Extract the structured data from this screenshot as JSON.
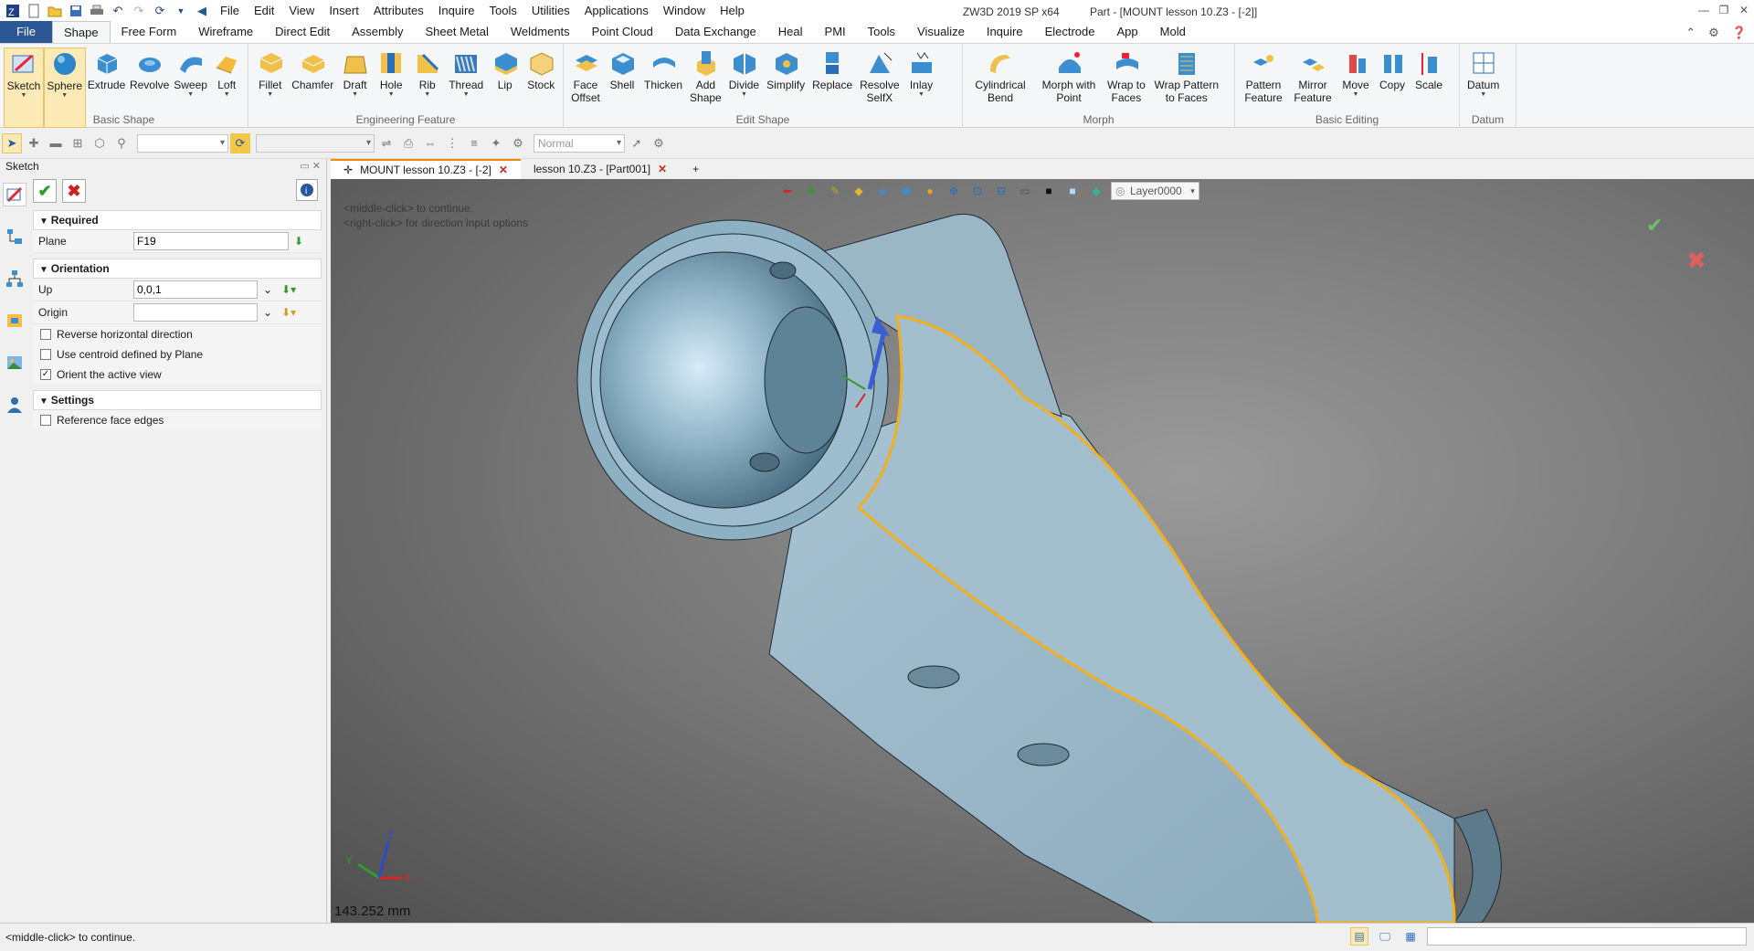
{
  "titlebar": {
    "app_title": "ZW3D 2019 SP x64",
    "doc_title": "Part - [MOUNT lesson 10.Z3 - [-2]]",
    "menus": [
      "File",
      "Edit",
      "View",
      "Insert",
      "Attributes",
      "Inquire",
      "Tools",
      "Utilities",
      "Applications",
      "Window",
      "Help"
    ]
  },
  "ribbon_tabs": [
    "File",
    "Shape",
    "Free Form",
    "Wireframe",
    "Direct Edit",
    "Assembly",
    "Sheet Metal",
    "Weldments",
    "Point Cloud",
    "Data Exchange",
    "Heal",
    "PMI",
    "Tools",
    "Visualize",
    "Inquire",
    "Electrode",
    "App",
    "Mold"
  ],
  "active_tab": "Shape",
  "ribbon": {
    "basic_shape": {
      "label": "Basic Shape",
      "buttons": [
        "Sketch",
        "Sphere",
        "Extrude",
        "Revolve",
        "Sweep",
        "Loft"
      ]
    },
    "engineering_feature": {
      "label": "Engineering Feature",
      "buttons": [
        "Fillet",
        "Chamfer",
        "Draft",
        "Hole",
        "Rib",
        "Thread",
        "Lip",
        "Stock"
      ]
    },
    "edit_shape": {
      "label": "Edit Shape",
      "buttons": [
        "Face\nOffset",
        "Shell",
        "Thicken",
        "Add\nShape",
        "Divide",
        "Simplify",
        "Replace",
        "Resolve\nSelfX",
        "Inlay"
      ]
    },
    "morph": {
      "label": "Morph",
      "buttons": [
        "Cylindrical\nBend",
        "Morph with\nPoint",
        "Wrap to\nFaces",
        "Wrap Pattern\nto Faces"
      ]
    },
    "basic_editing": {
      "label": "Basic Editing",
      "buttons": [
        "Pattern\nFeature",
        "Mirror\nFeature",
        "Move",
        "Copy",
        "Scale"
      ]
    },
    "datum": {
      "label": "Datum",
      "buttons": [
        "Datum"
      ]
    }
  },
  "toolbar2": {
    "render_mode": "Normal"
  },
  "panel": {
    "title": "Sketch",
    "required": {
      "label": "Required",
      "plane_label": "Plane",
      "plane_value": "F19"
    },
    "orientation": {
      "label": "Orientation",
      "up_label": "Up",
      "up_value": "0,0,1",
      "origin_label": "Origin",
      "origin_value": "",
      "reverse_horizontal": "Reverse horizontal direction",
      "use_centroid": "Use centroid defined by Plane",
      "orient_view": "Orient the active view",
      "reverse_horizontal_checked": false,
      "use_centroid_checked": false,
      "orient_view_checked": true
    },
    "settings": {
      "label": "Settings",
      "reference_face_edges": "Reference face edges",
      "reference_face_edges_checked": false
    }
  },
  "doc_tabs": [
    "MOUNT lesson 10.Z3 - [-2]",
    "lesson 10.Z3 - [Part001]"
  ],
  "viewport": {
    "hint_line1": "<middle-click> to continue.",
    "hint_line2": "<right-click> for direction input options",
    "layer": "Layer0000",
    "measurement": "143.252 mm",
    "axis_x": "X",
    "axis_y": "Y",
    "axis_z": "Z"
  },
  "status": {
    "text": "<middle-click> to continue."
  },
  "colors": {
    "file_tab": "#2b5797",
    "model": "#9fb8c8",
    "highlight_edge": "#f2b01e",
    "accent": "#f08a00"
  }
}
